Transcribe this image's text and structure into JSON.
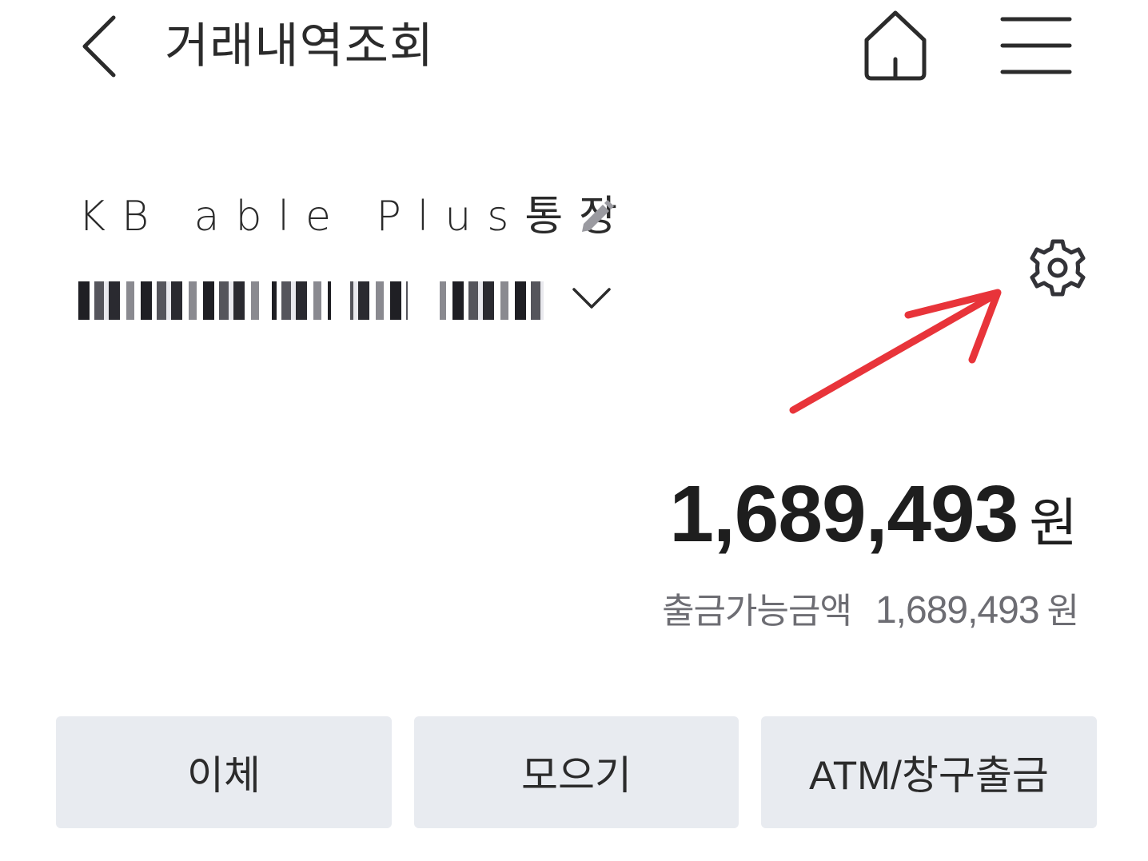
{
  "header": {
    "title": "거래내역조회",
    "back_icon": "chevron-left-icon",
    "home_icon": "home-icon",
    "menu_icon": "hamburger-menu-icon"
  },
  "account": {
    "name": "KB able Plus통장",
    "edit_icon": "pencil-icon",
    "number_masked": true,
    "dropdown_icon": "chevron-down-icon",
    "settings_icon": "gear-icon"
  },
  "balance": {
    "amount": "1,689,493",
    "unit": "원"
  },
  "withdrawable": {
    "label": "출금가능금액",
    "amount": "1,689,493",
    "unit": "원"
  },
  "actions": {
    "transfer": "이체",
    "collect": "모으기",
    "atm": "ATM/창구출금"
  },
  "colors": {
    "annotation_arrow": "#e8343a",
    "button_bg": "#e8ebf0",
    "secondary_text": "#6d6d73"
  }
}
